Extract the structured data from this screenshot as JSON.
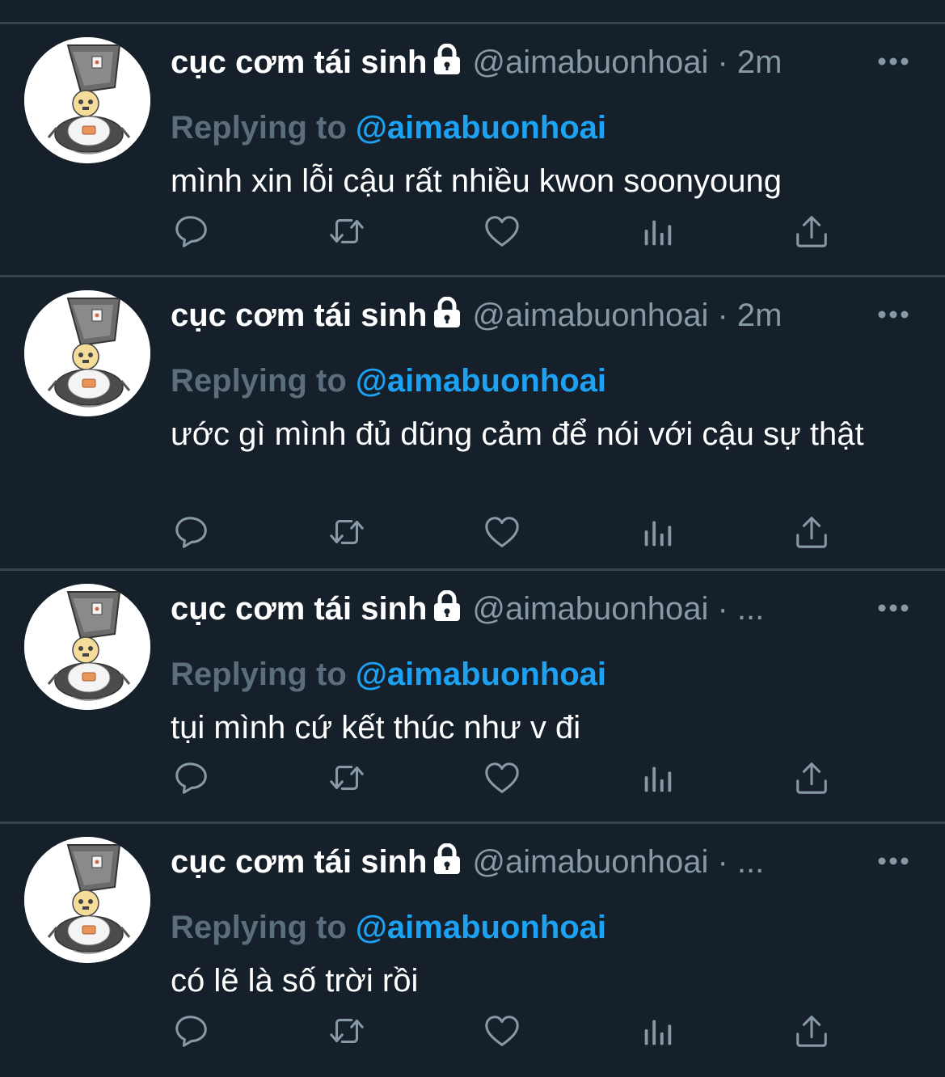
{
  "tweets": [
    {
      "name": "cục cơm tái sinh",
      "handle": "@aimabuonhoai",
      "dot": "·",
      "time": "2m",
      "replying_label": "Replying to",
      "reply_to": "@aimabuonhoai",
      "text": "mình xin lỗi cậu rất nhiều kwon soonyoung"
    },
    {
      "name": "cục cơm tái sinh",
      "handle": "@aimabuonhoai",
      "dot": "·",
      "time": "2m",
      "replying_label": "Replying to",
      "reply_to": "@aimabuonhoai",
      "text": "ước gì mình đủ dũng cảm để nói với cậu sự thật"
    },
    {
      "name": "cục cơm tái sinh",
      "handle": "@aimabuonhoai",
      "dot": "·",
      "time": "...",
      "replying_label": "Replying to",
      "reply_to": "@aimabuonhoai",
      "text": "tụi mình cứ kết thúc như v đi"
    },
    {
      "name": "cục cơm tái sinh",
      "handle": "@aimabuonhoai",
      "dot": "·",
      "time": "...",
      "replying_label": "Replying to",
      "reply_to": "@aimabuonhoai",
      "text": "có lẽ là số trời rồi"
    }
  ],
  "icons": {
    "lock": "lock-icon",
    "more": "more-dots-icon",
    "reply": "reply-bubble-icon",
    "retweet": "retweet-icon",
    "like": "heart-icon",
    "stats": "analytics-bars-icon",
    "share": "share-upload-icon"
  },
  "colors": {
    "background": "#15202b",
    "divider": "#38444d",
    "muted": "#8899a6",
    "link": "#1da1f2",
    "replying": "#5c6d7c"
  }
}
